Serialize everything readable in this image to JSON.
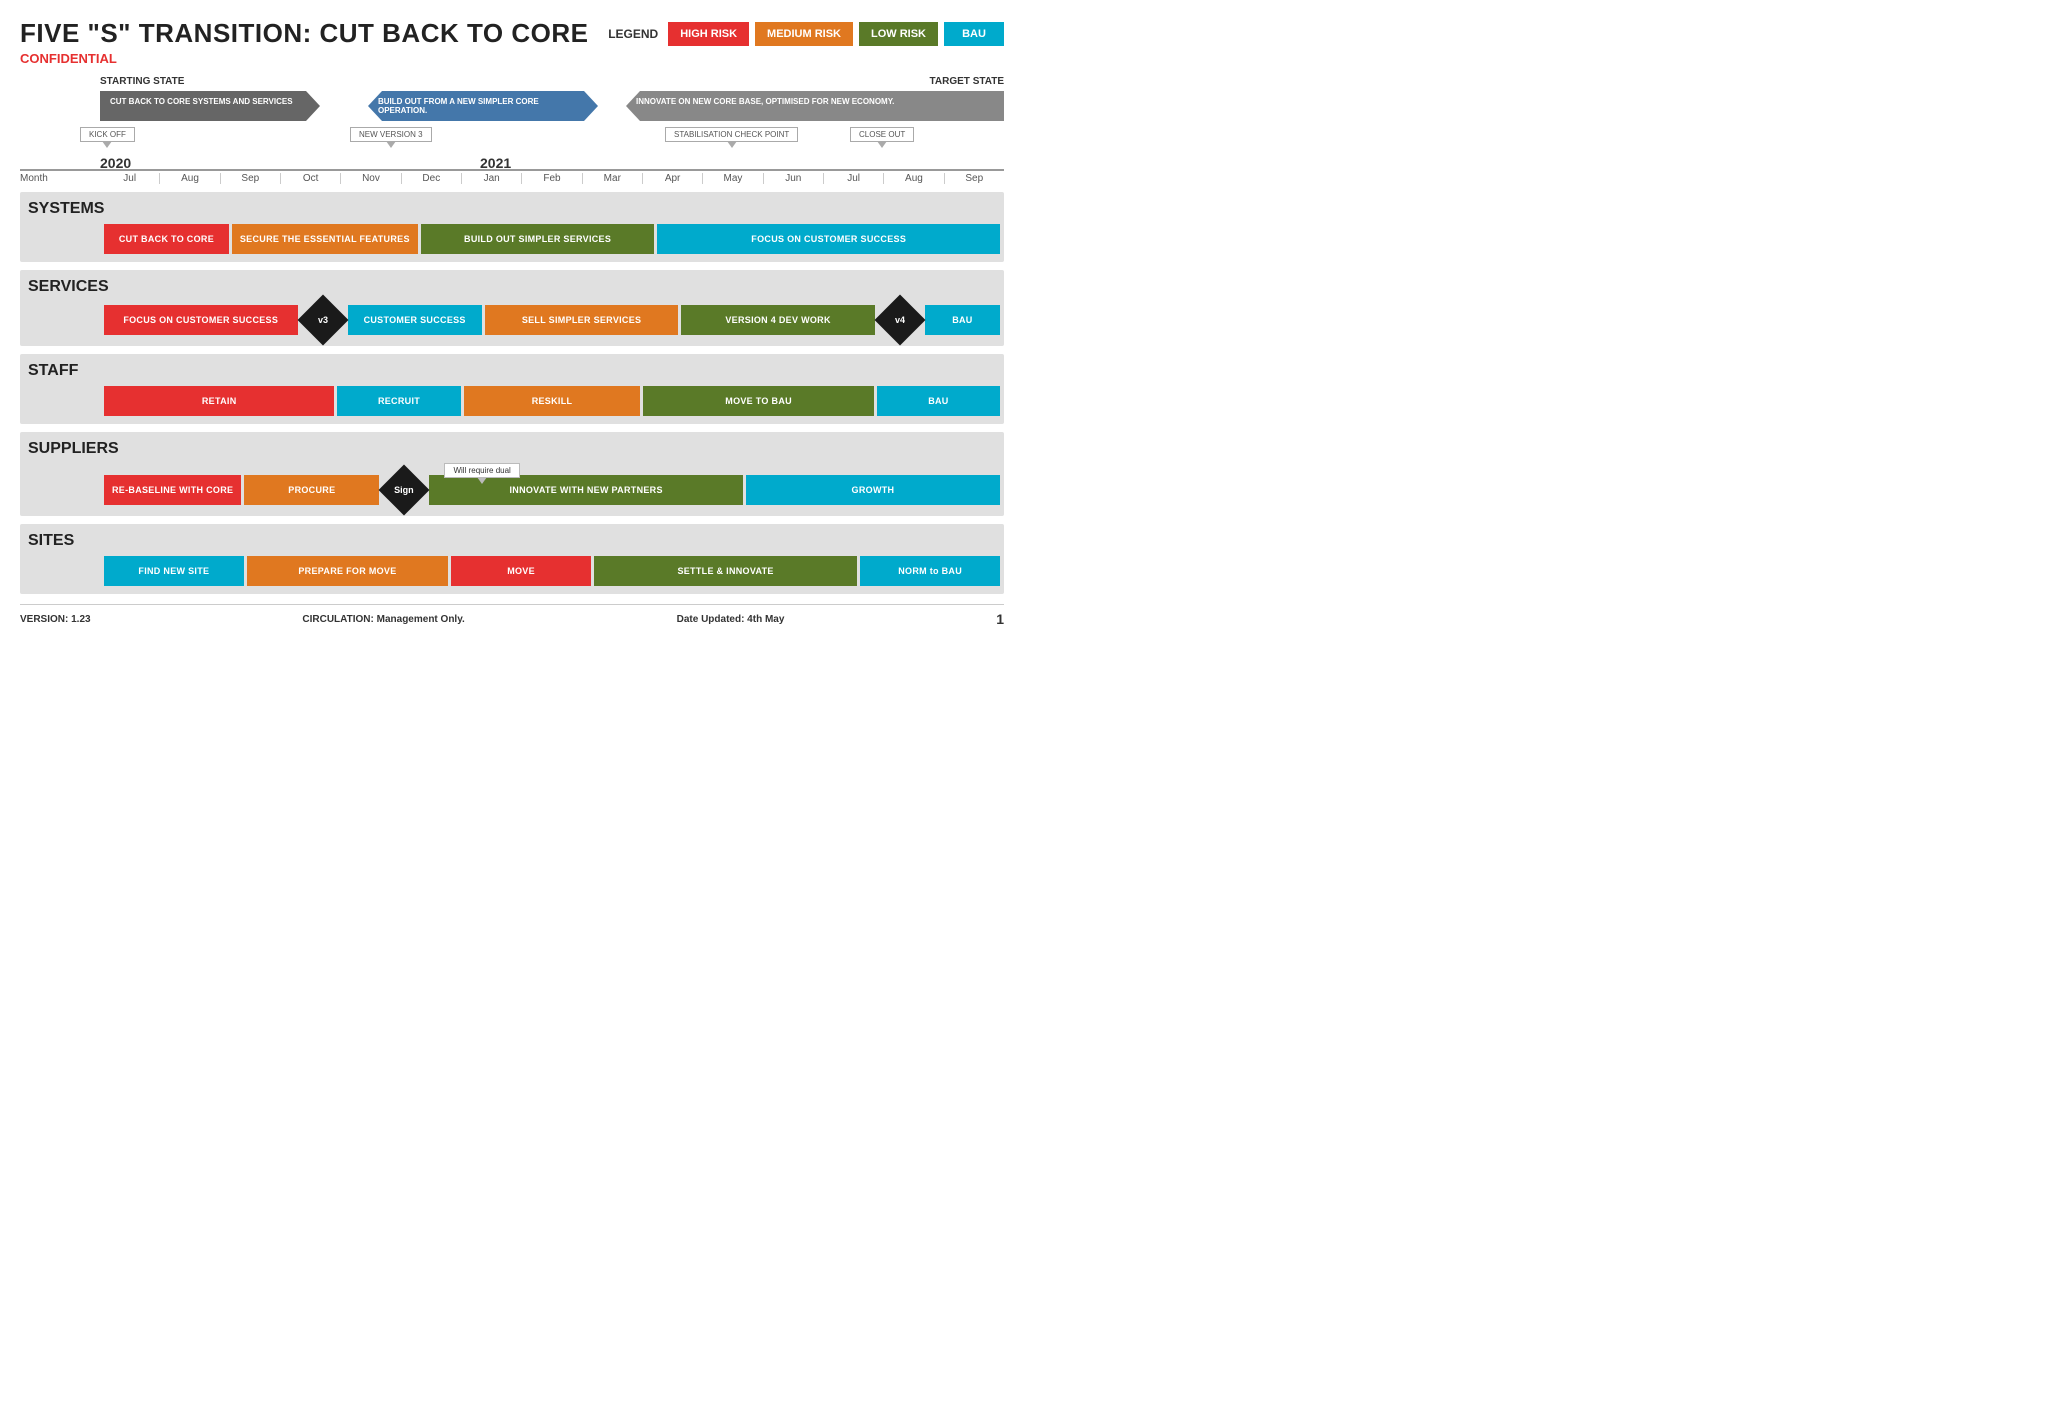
{
  "header": {
    "title": "FIVE \"S\" TRANSITION: CUT BACK TO CORE",
    "confidential": "CONFIDENTIAL"
  },
  "legend": {
    "label": "LEGEND",
    "items": [
      {
        "id": "high",
        "label": "HIGH RISK",
        "color": "#e63030"
      },
      {
        "id": "medium",
        "label": "MEDIUM RISK",
        "color": "#e07820"
      },
      {
        "id": "low",
        "label": "LOW RISK",
        "color": "#5a7a28"
      },
      {
        "id": "bau",
        "label": "BAU",
        "color": "#00aacc"
      }
    ]
  },
  "timeline": {
    "starting_state": "STARTING STATE",
    "target_state": "TARGET STATE",
    "banners": [
      {
        "label": "CUT BACK TO CORE SYSTEMS AND SERVICES",
        "color": "gray"
      },
      {
        "label": "BUILD OUT FROM A NEW SIMPLER CORE OPERATION.",
        "color": "blue"
      },
      {
        "label": "INNOVATE ON NEW CORE BASE, OPTIMISED FOR NEW ECONOMY.",
        "color": "darkgray"
      }
    ],
    "callouts": [
      {
        "label": "KICK OFF",
        "left": "10%"
      },
      {
        "label": "NEW VERSION 3",
        "left": "38%"
      },
      {
        "label": "STABILISATION CHECK POINT",
        "left": "73%"
      },
      {
        "label": "CLOSE OUT",
        "left": "88%"
      }
    ],
    "year2020": "2020",
    "year2021": "2021",
    "months": [
      "Jul",
      "Aug",
      "Sep",
      "Oct",
      "Nov",
      "Dec",
      "Jan",
      "Feb",
      "Mar",
      "Apr",
      "May",
      "Jun",
      "Jul",
      "Aug",
      "Sep"
    ]
  },
  "sections": {
    "systems": {
      "title": "SYSTEMS",
      "bars": [
        {
          "label": "CUT BACK TO CORE",
          "color": "red",
          "span": 2
        },
        {
          "label": "SECURE THE ESSENTIAL FEATURES",
          "color": "orange",
          "span": 3
        },
        {
          "label": "BUILD OUT SIMPLER SERVICES",
          "color": "green",
          "span": 4
        },
        {
          "label": "FOCUS ON CUSTOMER SUCCESS",
          "color": "blue",
          "span": 6
        }
      ]
    },
    "services": {
      "title": "SERVICES",
      "bars": [
        {
          "label": "FOCUS ON CUSTOMER SUCCESS",
          "color": "red",
          "span": 3
        },
        {
          "label": "v3",
          "color": "diamond"
        },
        {
          "label": "CUSTOMER SUCCESS",
          "color": "blue",
          "span": 2
        },
        {
          "label": "SELL SIMPLER SERVICES",
          "color": "orange",
          "span": 3
        },
        {
          "label": "VERSION 4 DEV WORK",
          "color": "green",
          "span": 3
        },
        {
          "label": "v4",
          "color": "diamond"
        },
        {
          "label": "BAU",
          "color": "blue",
          "span": 1
        }
      ]
    },
    "staff": {
      "title": "STAFF",
      "bars": [
        {
          "label": "RETAIN",
          "color": "red",
          "span": 4
        },
        {
          "label": "RECRUIT",
          "color": "blue",
          "span": 2
        },
        {
          "label": "RESKILL",
          "color": "orange",
          "span": 3
        },
        {
          "label": "MOVE TO BAU",
          "color": "green",
          "span": 4
        },
        {
          "label": "BAU",
          "color": "blue",
          "span": 2
        }
      ]
    },
    "suppliers": {
      "title": "SUPPLIERS",
      "callout": "Will require dual",
      "bars": [
        {
          "label": "RE-BASELINE WITH CORE",
          "color": "red",
          "span": 2
        },
        {
          "label": "PROCURE",
          "color": "orange",
          "span": 2
        },
        {
          "label": "Sign",
          "color": "diamond"
        },
        {
          "label": "INNOVATE WITH NEW PARTNERS",
          "color": "green",
          "span": 5
        },
        {
          "label": "GROWTH",
          "color": "blue",
          "span": 4
        }
      ]
    },
    "sites": {
      "title": "SITES",
      "bars": [
        {
          "label": "FIND NEW SITE",
          "color": "blue",
          "span": 2
        },
        {
          "label": "PREPARE FOR MOVE",
          "color": "orange",
          "span": 3
        },
        {
          "label": "MOVE",
          "color": "red",
          "span": 2
        },
        {
          "label": "SETTLE & INNOVATE",
          "color": "green",
          "span": 4
        },
        {
          "label": "NORM to BAU",
          "color": "blue",
          "span": 2
        }
      ]
    }
  },
  "footer": {
    "version": "VERSION: 1.23",
    "circulation": "CIRCULATION: Management Only.",
    "date_updated": "Date Updated: 4th May",
    "page": "1"
  }
}
